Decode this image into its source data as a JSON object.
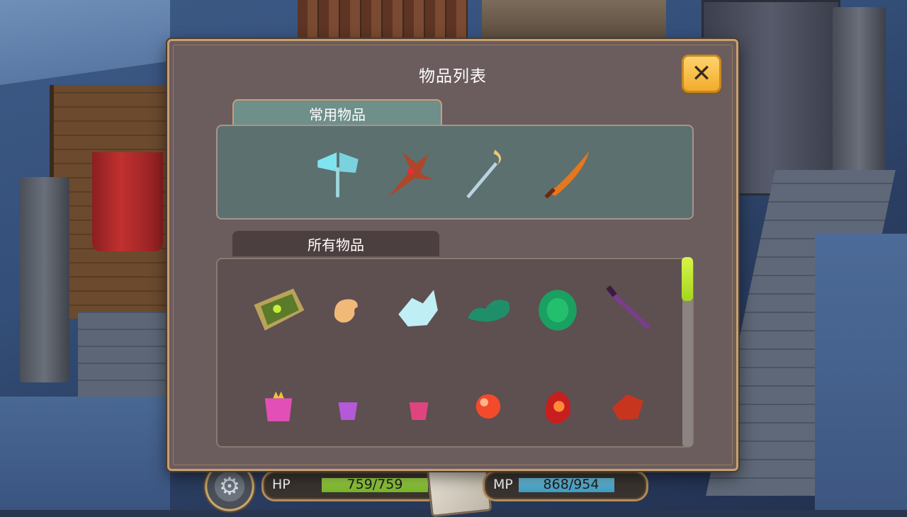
{
  "dialog": {
    "title": "物品列表",
    "close_label": "✕",
    "common_section_label": "常用物品",
    "all_section_label": "所有物品"
  },
  "common_items": [
    {
      "icon": "ice-axe-icon",
      "color": "#7fe3f0"
    },
    {
      "icon": "dragon-claw-staff-icon",
      "color": "#b0452a"
    },
    {
      "icon": "crescent-staff-icon",
      "color": "#b9d3e0"
    },
    {
      "icon": "flame-sword-icon",
      "color": "#e8761c"
    }
  ],
  "all_items": [
    {
      "icon": "green-shield-icon",
      "color": "#b8a35a"
    },
    {
      "icon": "bread-piece-icon",
      "color": "#f1b978"
    },
    {
      "icon": "ice-crystal-icon",
      "color": "#bfeff4"
    },
    {
      "icon": "green-leaf-icon",
      "color": "#1f8f6a"
    },
    {
      "icon": "green-gem-icon",
      "color": "#1aa060"
    },
    {
      "icon": "purple-sword-icon",
      "color": "#7a3d8a"
    },
    {
      "icon": "pink-crown-cup-icon",
      "color": "#e24fb6"
    },
    {
      "icon": "purple-cup-icon",
      "color": "#b45ad8"
    },
    {
      "icon": "pink-cup-icon",
      "color": "#e0447f"
    },
    {
      "icon": "red-orb-icon",
      "color": "#f24a2a"
    },
    {
      "icon": "fire-stone-icon",
      "color": "#c81e1e"
    },
    {
      "icon": "red-crystal-icon",
      "color": "#c8351e"
    }
  ],
  "hud": {
    "hp_label": "HP",
    "hp_value": "759/759",
    "hp_fraction": 1.0,
    "mp_label": "MP",
    "mp_value": "868/954",
    "mp_fraction": 0.91
  },
  "colors": {
    "dialog_bg": "#6b5c5e",
    "dialog_border": "#c7a070",
    "close_button": "#f2ac2a",
    "hp_bar": "#8cc63f",
    "mp_bar": "#4aa8cc",
    "scroll_thumb": "#c2e838"
  }
}
